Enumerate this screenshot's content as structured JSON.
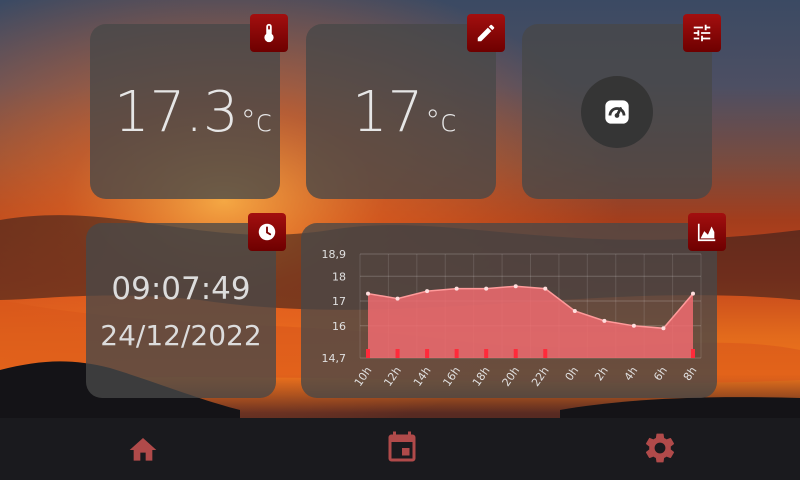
{
  "measured_temperature": {
    "value": "17.3",
    "unit": "°c"
  },
  "setpoint_temperature": {
    "value": "17",
    "unit": "°c"
  },
  "clock": {
    "time": "09:07:49",
    "date": "24/12/2022"
  },
  "chart_data": {
    "type": "area",
    "x": [
      "10h",
      "12h",
      "14h",
      "16h",
      "18h",
      "20h",
      "22h",
      "0h",
      "2h",
      "4h",
      "6h",
      "8h"
    ],
    "series": [
      {
        "values": [
          17.3,
          17.1,
          17.4,
          17.5,
          17.5,
          17.6,
          17.5,
          16.6,
          16.2,
          16.0,
          15.9,
          17.3
        ]
      }
    ],
    "y_tick_labels": [
      "18,9",
      "18",
      "17",
      "16",
      "14,7"
    ],
    "ylim": [
      14.7,
      18.9
    ],
    "grid": true,
    "colors": {
      "area": "#f06b70",
      "line": "#ffffff",
      "markers": "#ff2a3a"
    }
  },
  "nav": {
    "home": "home-icon",
    "calendar": "calendar-icon",
    "settings": "gear-icon"
  },
  "colors": {
    "accent": "#8b0000",
    "nav_icon": "#b04a4a",
    "card_bg": "#484848"
  }
}
